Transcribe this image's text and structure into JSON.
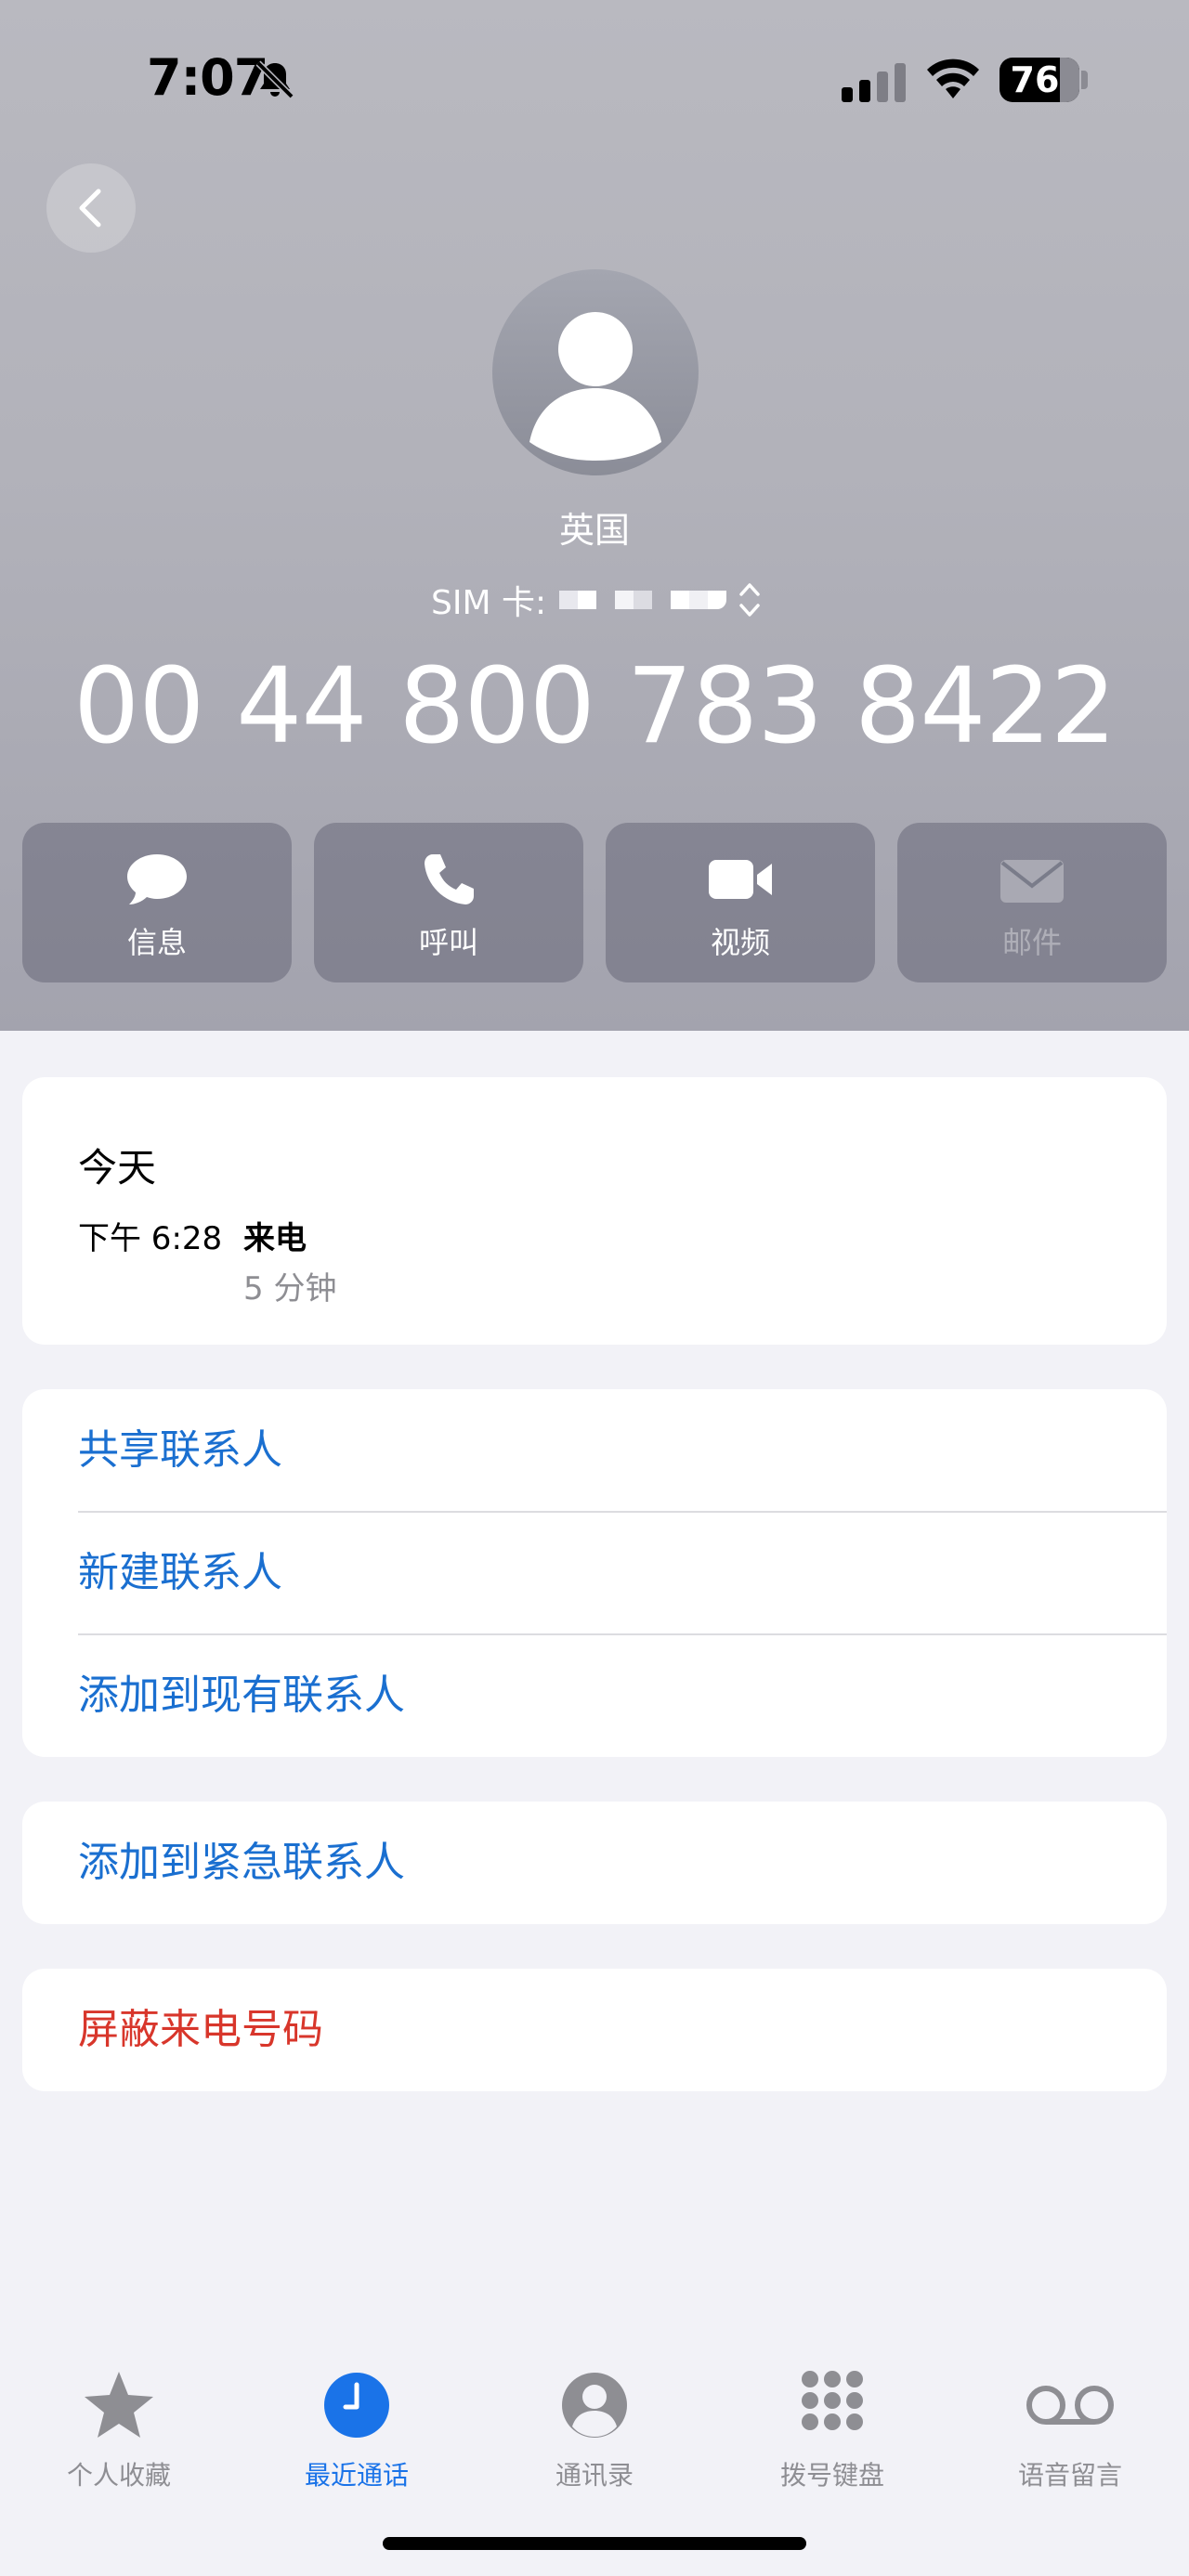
{
  "status_bar": {
    "time": "7:07",
    "battery": "76",
    "battery_level": 0.76,
    "icons": [
      "bell-slash-icon",
      "cellular-signal-icon",
      "wifi-icon",
      "battery-icon"
    ]
  },
  "header": {
    "back_icon": "chevron-left-icon",
    "location": "英国",
    "sim_label": "SIM 卡:",
    "phone_number": "00 44 800 783 8422"
  },
  "actions": [
    {
      "label": "信息",
      "icon": "message-bubble-icon",
      "enabled": true
    },
    {
      "label": "呼叫",
      "icon": "phone-icon",
      "enabled": true
    },
    {
      "label": "视频",
      "icon": "video-camera-icon",
      "enabled": true
    },
    {
      "label": "邮件",
      "icon": "mail-icon",
      "enabled": false
    }
  ],
  "recent": {
    "day": "今天",
    "time": "下午 6:28",
    "type": "来电",
    "duration": "5 分钟"
  },
  "options": {
    "share_contact": "共享联系人",
    "new_contact": "新建联系人",
    "add_existing": "添加到现有联系人",
    "add_emergency": "添加到紧急联系人",
    "block_caller": "屏蔽来电号码"
  },
  "colors": {
    "accent": "#1a73e8",
    "link": "#1a6fd0",
    "destructive": "#d8362b"
  },
  "tabs": [
    {
      "label": "个人收藏",
      "icon": "star-icon",
      "active": false
    },
    {
      "label": "最近通话",
      "icon": "clock-icon",
      "active": true
    },
    {
      "label": "通讯录",
      "icon": "person-circle-icon",
      "active": false
    },
    {
      "label": "拨号键盘",
      "icon": "keypad-icon",
      "active": false
    },
    {
      "label": "语音留言",
      "icon": "voicemail-icon",
      "active": false
    }
  ]
}
